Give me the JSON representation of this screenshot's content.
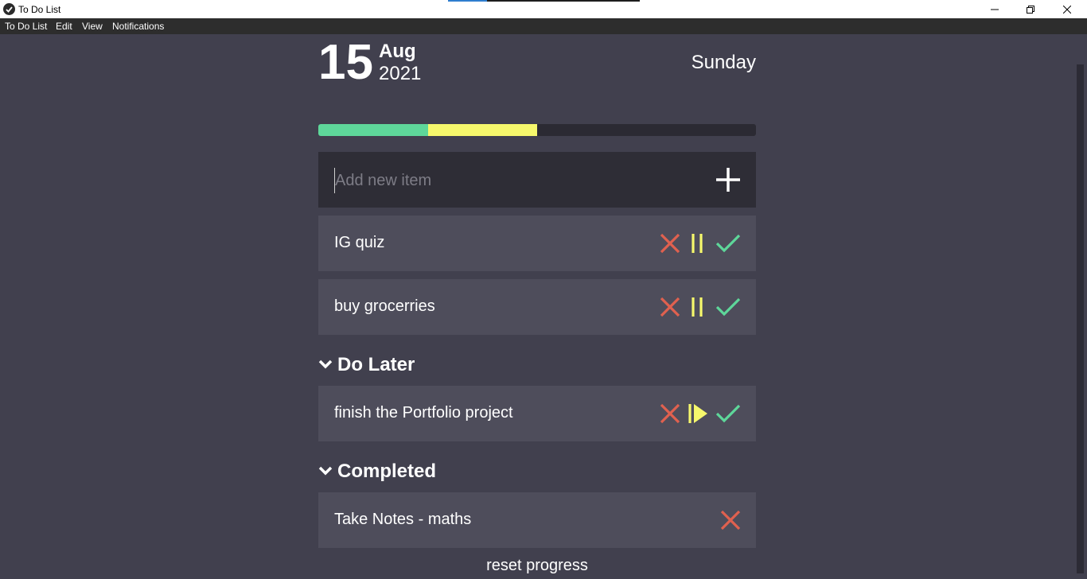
{
  "window": {
    "title": "To Do List"
  },
  "menu": [
    "To Do List",
    "Edit",
    "View",
    "Notifications"
  ],
  "date": {
    "day": "15",
    "month": "Aug",
    "year": "2021",
    "weekday": "Sunday"
  },
  "progress": {
    "completed_fraction": 0.25,
    "later_fraction": 0.25
  },
  "input": {
    "placeholder": "Add new item",
    "value": ""
  },
  "tasks": [
    {
      "label": "IG quiz"
    },
    {
      "label": "buy grocerries"
    }
  ],
  "do_later": {
    "heading": "Do Later",
    "items": [
      {
        "label": "finish the Portfolio project"
      }
    ]
  },
  "completed": {
    "heading": "Completed",
    "items": [
      {
        "label": "Take Notes - maths"
      }
    ]
  },
  "reset_label": "reset progress",
  "colors": {
    "background": "#41404e",
    "card": "#4e4d5b",
    "input_bg": "#2e2d36",
    "green": "#5ed79a",
    "yellow": "#f6f86c",
    "red": "#e0614f"
  }
}
